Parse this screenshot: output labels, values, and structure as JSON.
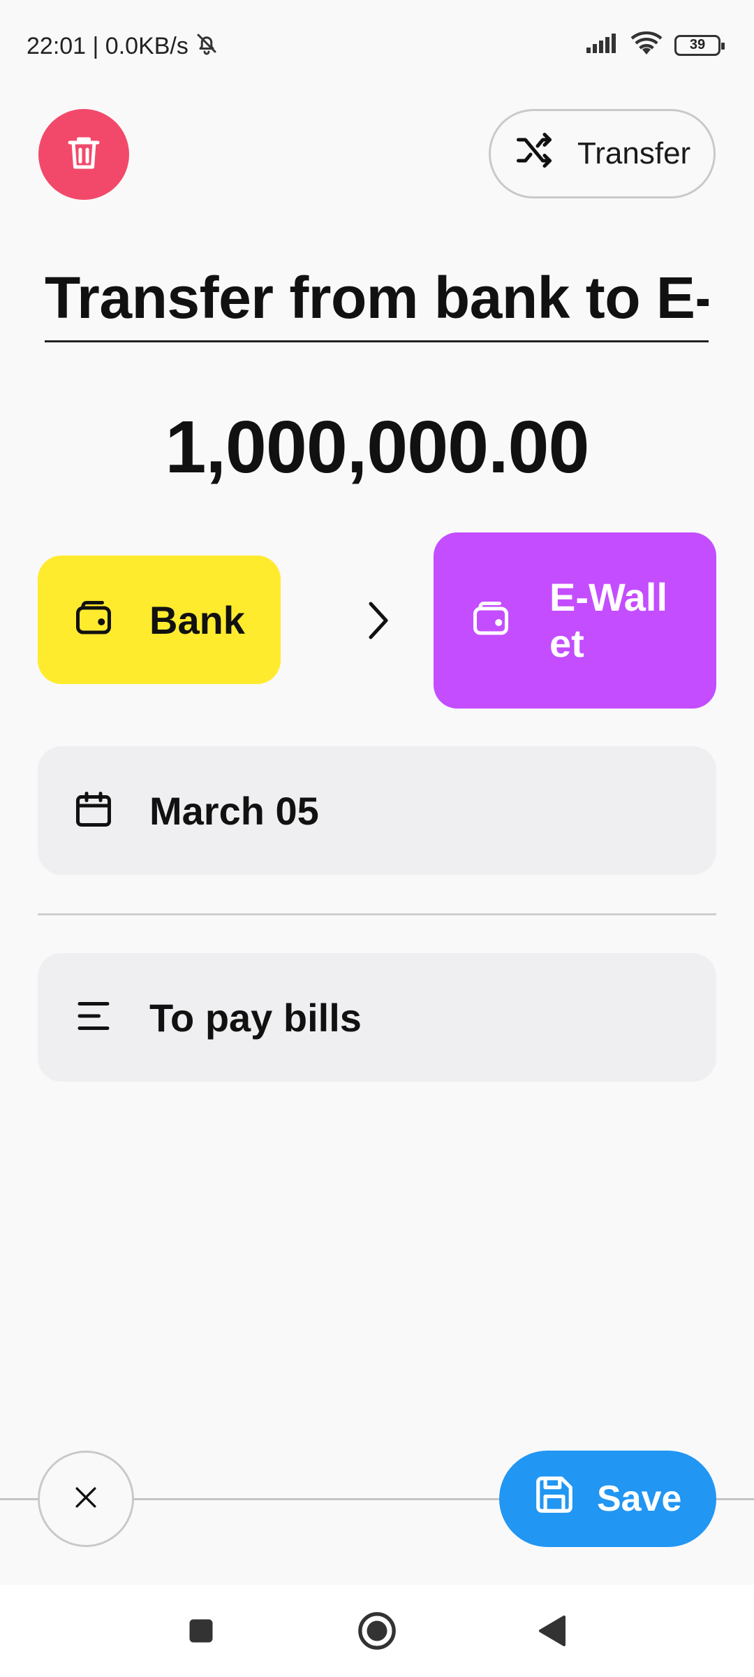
{
  "status_bar": {
    "time_speed": "22:01 | 0.0KB/s",
    "battery": "39",
    "icons": [
      "mute-bell-icon",
      "signal-icon",
      "wifi-icon",
      "battery-icon"
    ]
  },
  "header": {
    "delete_icon": "trash-icon",
    "type_toggle": {
      "label": "Transfer",
      "icon": "shuffle-icon"
    }
  },
  "transaction": {
    "title": "Transfer from bank to E-wallet",
    "amount": "1,000,000.00"
  },
  "accounts": {
    "from": {
      "label": "Bank",
      "icon": "wallet-icon",
      "color": "#ffeb2e"
    },
    "to": {
      "label": "E-Wallet",
      "icon": "wallet-icon",
      "color": "#c44dff"
    }
  },
  "date": {
    "label": "March 05",
    "icon": "calendar-icon"
  },
  "note": {
    "label": "To pay bills",
    "icon": "notes-icon"
  },
  "actions": {
    "cancel_icon": "close-icon",
    "save_label": "Save",
    "save_icon": "floppy-disk-icon",
    "accent": "#2196f3"
  },
  "delete_color": "#f2496a"
}
